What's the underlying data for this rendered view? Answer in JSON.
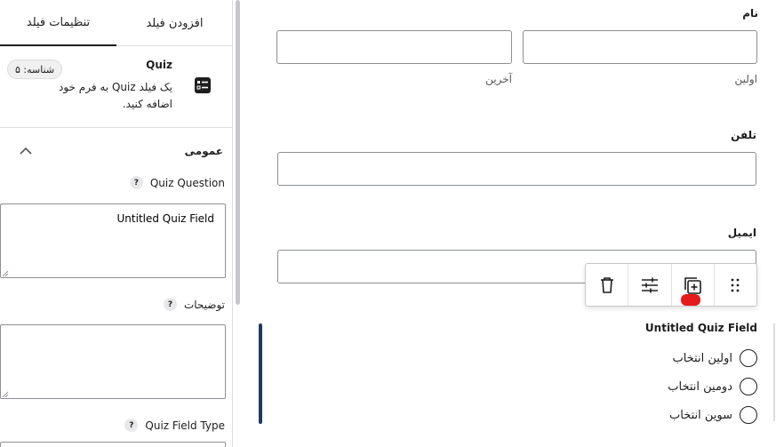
{
  "tabs": {
    "settings": "تنظیمات فیلد",
    "add": "افزودن فیلد"
  },
  "block": {
    "title": "Quiz",
    "description": "یک فیلد Quiz به فرم خود اضافه کنید.",
    "id_badge": "شناسه: ۵",
    "icon": "list-icon"
  },
  "section": {
    "title": "عمومی",
    "icon": "chevron-up-icon"
  },
  "fields": {
    "question_label": "Quiz Question",
    "question_value": "Untitled Quiz Field",
    "description_label": "توضیحات",
    "description_value": "",
    "type_label": "Quiz Field Type",
    "help": "?"
  },
  "form": {
    "name_label": "نام",
    "first_sublabel": "اولین",
    "last_sublabel": "آخرین",
    "phone_label": "تلفن",
    "email_label": "ایمیل",
    "quiz_title": "Untitled Quiz Field",
    "options": [
      "اولین انتخاب",
      "دومین انتخاب",
      "سوین انتخاب"
    ]
  },
  "toolbar": {
    "delete": "trash-icon",
    "settings": "sliders-icon",
    "duplicate": "duplicate-icon",
    "drag": "drag-handle-icon"
  },
  "colors": {
    "accent": "#1e3a5f",
    "marker": "#e51b1b",
    "border": "#8c8f94"
  }
}
